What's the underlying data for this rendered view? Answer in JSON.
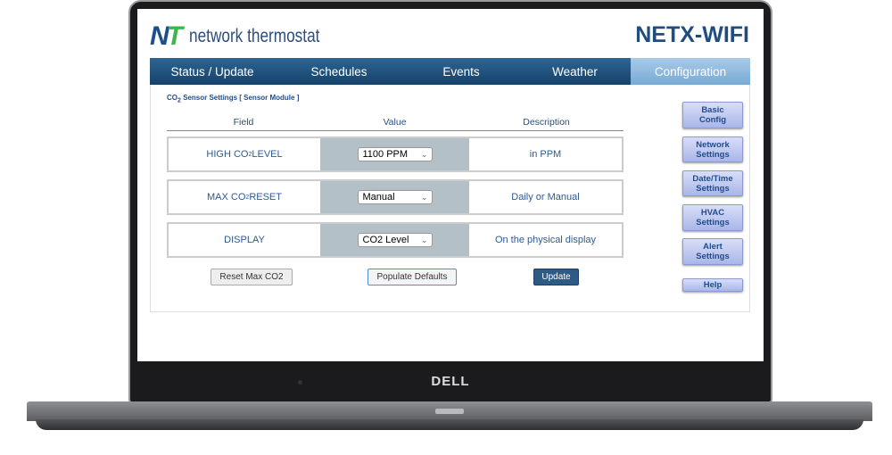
{
  "device": {
    "brand": "DELL"
  },
  "header": {
    "logo_mark": "NT",
    "logo_text": "network thermostat",
    "product": "NETX-WIFI"
  },
  "nav": {
    "tabs": [
      {
        "label": "Status / Update"
      },
      {
        "label": "Schedules"
      },
      {
        "label": "Events"
      },
      {
        "label": "Weather"
      },
      {
        "label": "Configuration",
        "active": true
      }
    ]
  },
  "panel": {
    "title_pre": "CO",
    "title_sub": "2",
    "title_post": " Sensor Settings [ Sensor Module ]",
    "columns": [
      "Field",
      "Value",
      "Description"
    ],
    "rows": [
      {
        "field_pre": "HIGH CO",
        "field_sub": "2",
        "field_post": " LEVEL",
        "value": "1100 PPM",
        "description": "in PPM"
      },
      {
        "field_pre": "MAX CO",
        "field_sub": "2",
        "field_post": " RESET",
        "value": "Manual",
        "description": "Daily or Manual"
      },
      {
        "field_pre": "DISPLAY",
        "field_sub": "",
        "field_post": "",
        "value": "CO2 Level",
        "description": "On the physical display"
      }
    ],
    "buttons": {
      "reset": "Reset Max CO2",
      "defaults": "Populate Defaults",
      "update": "Update"
    }
  },
  "sidebar": {
    "items": [
      {
        "l1": "Basic",
        "l2": "Config"
      },
      {
        "l1": "Network",
        "l2": "Settings"
      },
      {
        "l1": "Date/Time",
        "l2": "Settings"
      },
      {
        "l1": "HVAC",
        "l2": "Settings"
      },
      {
        "l1": "Alert",
        "l2": "Settings"
      },
      {
        "l1": "Help",
        "l2": ""
      }
    ]
  },
  "colors": {
    "nav": "#1f4d7f",
    "active_tab": "#8fb9de",
    "value_cell": "#b4c0c8",
    "update_btn": "#2e5b85"
  }
}
